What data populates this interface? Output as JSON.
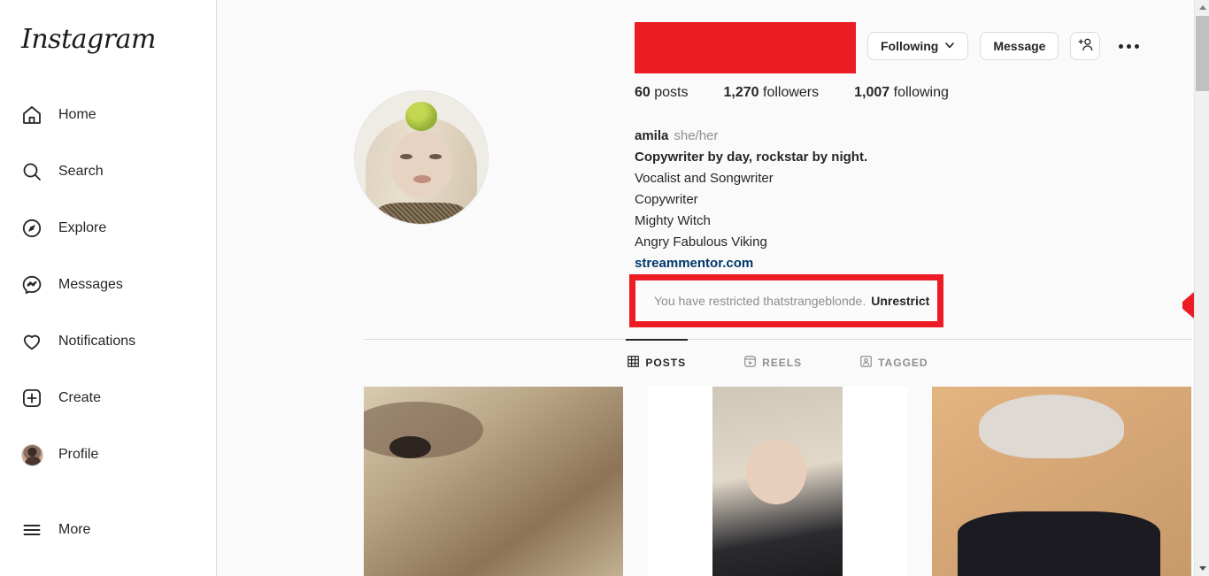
{
  "brand": {
    "name": "Instagram"
  },
  "sidebar": {
    "items": [
      {
        "label": "Home",
        "icon": "home-icon"
      },
      {
        "label": "Search",
        "icon": "search-icon"
      },
      {
        "label": "Explore",
        "icon": "compass-icon"
      },
      {
        "label": "Messages",
        "icon": "messenger-icon"
      },
      {
        "label": "Notifications",
        "icon": "heart-icon"
      },
      {
        "label": "Create",
        "icon": "plus-square-icon"
      },
      {
        "label": "Profile",
        "icon": "avatar-icon"
      },
      {
        "label": "More",
        "icon": "hamburger-icon"
      }
    ]
  },
  "profile": {
    "username_redacted": true,
    "redaction_color": "#ED1C24",
    "actions": {
      "following_label": "Following",
      "message_label": "Message",
      "add_person_icon": "person-add-icon",
      "more_options_icon": "ellipsis-icon"
    },
    "stats": [
      {
        "value": "60",
        "label": "posts"
      },
      {
        "value": "1,270",
        "label": "followers"
      },
      {
        "value": "1,007",
        "label": "following"
      }
    ],
    "bio": {
      "name": "amila",
      "pronouns": "she/her",
      "headline": "Copywriter by day, rockstar by night.",
      "lines": [
        "Vocalist and Songwriter",
        "Copywriter",
        "Mighty Witch",
        "Angry Fabulous Viking"
      ],
      "link": "streammentor.com"
    },
    "restriction": {
      "message": "You have restricted thatstrangeblonde.",
      "action_label": "Unrestrict",
      "annotation_color": "#ED1C24"
    }
  },
  "tabs": [
    {
      "label": "POSTS",
      "icon": "grid-icon",
      "active": true
    },
    {
      "label": "REELS",
      "icon": "reels-icon",
      "active": false
    },
    {
      "label": "TAGGED",
      "icon": "tagged-icon",
      "active": false
    }
  ],
  "posts": [
    {
      "alt": "close-up-blonde-hair-face"
    },
    {
      "alt": "portrait-hand-on-chin"
    },
    {
      "alt": "blonde-woman-black-jacket"
    }
  ]
}
